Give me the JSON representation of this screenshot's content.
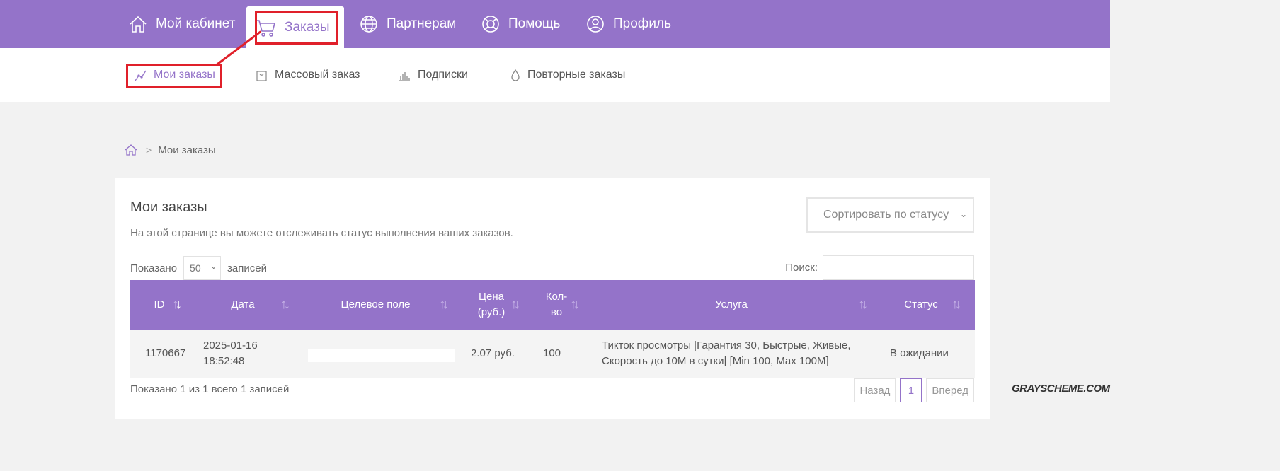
{
  "topnav": {
    "items": [
      {
        "label": "Мой кабинет",
        "icon": "home-icon"
      },
      {
        "label": "Заказы",
        "icon": "cart-icon",
        "active": true
      },
      {
        "label": "Партнерам",
        "icon": "globe-icon"
      },
      {
        "label": "Помощь",
        "icon": "lifebuoy-icon"
      },
      {
        "label": "Профиль",
        "icon": "user-icon"
      }
    ]
  },
  "subnav": {
    "items": [
      {
        "label": "Мои заказы",
        "icon": "chart-line-icon",
        "active": true
      },
      {
        "label": "Массовый заказ",
        "icon": "bag-icon"
      },
      {
        "label": "Подписки",
        "icon": "bar-chart-icon"
      },
      {
        "label": "Повторные заказы",
        "icon": "drop-icon"
      }
    ]
  },
  "breadcrumb": {
    "current": "Мои заказы",
    "separator": ">"
  },
  "card": {
    "title": "Мои заказы",
    "description": "На этой странице вы можете отслеживать статус выполнения ваших заказов.",
    "status_filter": "Сортировать по статусу"
  },
  "table_controls": {
    "shown_label": "Показано",
    "page_length": "50",
    "records_label": "записей",
    "search_label": "Поиск:"
  },
  "table": {
    "columns": {
      "id": "ID",
      "date": "Дата",
      "target": "Целевое поле",
      "price_1": "Цена",
      "price_2": "(руб.)",
      "qty_1": "Кол-",
      "qty_2": "во",
      "service": "Услуга",
      "status": "Статус"
    },
    "rows": [
      {
        "id": "1170667",
        "date_1": "2025-01-16",
        "date_2": "18:52:48",
        "price": "2.07 руб.",
        "qty": "100",
        "service_1": "Тикток просмотры |Гарантия 30, Быстрые, Живые,",
        "service_2": "Скорость до 10М в сутки| [Min 100, Max 100M]",
        "status": "В ожидании"
      }
    ]
  },
  "footer": {
    "info": "Показано 1 из 1 всего 1 записей",
    "prev": "Назад",
    "page": "1",
    "next": "Вперед"
  },
  "watermark": "GRAYSCHEME.COM",
  "colors": {
    "accent": "#9473c9",
    "highlight": "#e0202a"
  }
}
